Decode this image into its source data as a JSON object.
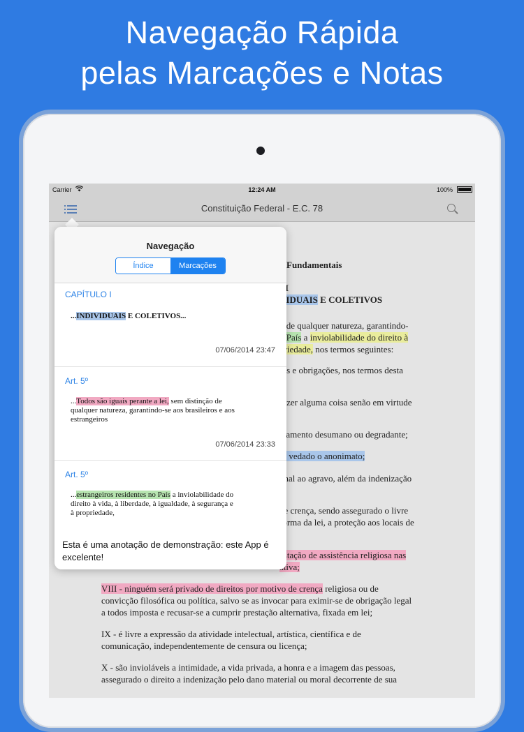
{
  "headline": {
    "line1": "Navegação Rápida",
    "line2": "pelas Marcações e Notas"
  },
  "statusbar": {
    "carrier": "Carrier",
    "time": "12:24 AM",
    "battery": "100%"
  },
  "navbar": {
    "title": "Constituição Federal - E.C. 78"
  },
  "document": {
    "heading1": "Fundamentais",
    "heading2": "I",
    "heading3_hl": "VIDUAIS",
    "heading3_rest": " E COLETIVOS",
    "l1": "o de qualquer natureza, garantindo-",
    "l2_hl1": "o País",
    "l2_mid": " a ",
    "l2_hl2": "inviolabilidade do direito à",
    "l3_hl": "priedade,",
    "l3_rest": " nos termos seguintes:",
    "l4": "tos e obrigações, nos termos desta",
    "l5": "fazer alguma coisa senão em virtude",
    "l6": "atamento desumano ou degradante;",
    "l7_hl": "lo vedado o anonimato;",
    "l8": "onal ao agravo, além da indenização",
    "l9": "de crença, sendo assegurado o livre",
    "l10": "forma da lei, a proteção aos locais de",
    "l11_hl": "estação de assistência religiosa nas",
    "l12_hl": "ativa;",
    "p8_hl": "VIII - ninguém será privado de direitos por motivo de crença",
    "p8_rest": " religiosa ou de",
    "p8_l2": "convicção filosófica ou política, salvo se as invocar para eximir-se de obrigação legal",
    "p8_l3": "a todos imposta e recusar-se a cumprir prestação alternativa, fixada em lei;",
    "p9_l1": "IX - é livre a expressão da atividade intelectual, artística, científica e de",
    "p9_l2": "comunicação, independentemente de censura ou licença;",
    "p10_l1": "X - são invioláveis a intimidade, a vida privada, a honra e a imagem das pessoas,",
    "p10_l2": "assegurado o direito a indenização pelo dano material ou moral decorrente de sua"
  },
  "popover": {
    "title": "Navegação",
    "segments": [
      "Índice",
      "Marcações"
    ],
    "entries": [
      {
        "head": "CAPÍTULO I",
        "pre": "...",
        "hl": "INDIVIDUAIS",
        "post": " E COLETIVOS...",
        "date": "07/06/2014 23:47"
      },
      {
        "head": "Art. 5º",
        "pre": "...",
        "hl": "Todos são iguais perante a lei,",
        "post": " sem distinção de qualquer natureza, garantindo-se aos brasileiros e aos estrangeiros",
        "date": "07/06/2014 23:33"
      },
      {
        "head": "Art. 5º",
        "pre": "...",
        "hl": "estrangeiros residentes no País",
        "post": " a inviolabilidade do direito à vida, à liberdade, à igualdade, à segurança e à propriedade,",
        "date": ""
      }
    ],
    "note": "Esta é uma anotação de demonstração: este App é excelente!"
  },
  "colors": {
    "background": "#2f7be2",
    "accent": "#1e82f0",
    "highlight_blue": "#a9c6ea",
    "highlight_green": "#b7e4b0",
    "highlight_pink": "#f1a9c2",
    "highlight_yellow": "#e9ec9c"
  },
  "icons": {
    "menu": "list-icon",
    "search": "search-icon",
    "wifi": "wifi-icon",
    "battery": "battery-icon"
  }
}
